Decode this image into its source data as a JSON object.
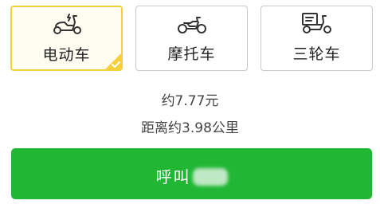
{
  "vehicle_options": [
    {
      "label": "电动车",
      "icon": "electric-scooter-icon",
      "selected": true
    },
    {
      "label": "摩托车",
      "icon": "motorcycle-icon",
      "selected": false
    },
    {
      "label": "三轮车",
      "icon": "tricycle-icon",
      "selected": false
    }
  ],
  "price_text": "约7.77元",
  "distance_text": "距离约3.98公里",
  "call_button": {
    "label": "呼叫"
  },
  "colors": {
    "selected_border": "#f5cf3c",
    "button_green": "#21b734",
    "icon_stroke": "#333333"
  }
}
